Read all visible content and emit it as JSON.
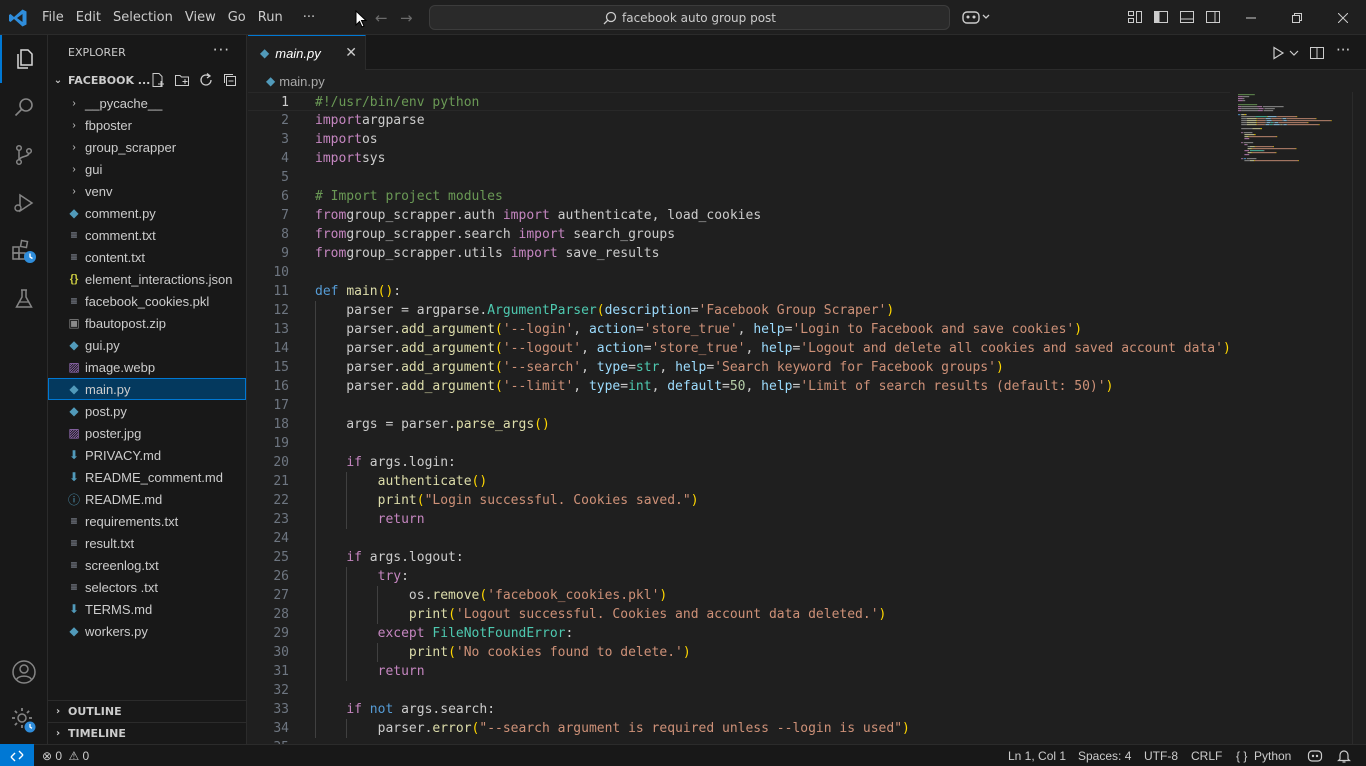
{
  "titlebar": {
    "menu": [
      "File",
      "Edit",
      "Selection",
      "View",
      "Go",
      "Run",
      "···"
    ],
    "search_text": "facebook auto group post",
    "window_controls": [
      "minimize-icon",
      "restore-icon",
      "close-icon"
    ]
  },
  "activitybar": {
    "items": [
      "explorer-icon",
      "search-icon",
      "source-control-icon",
      "run-debug-icon",
      "extensions-icon",
      "testing-icon"
    ],
    "bottom": [
      "account-icon",
      "manage-gear-icon"
    ]
  },
  "sidebar": {
    "title": "EXPLORER",
    "more": "···",
    "folder_name": "FACEBOOK ...",
    "items": [
      {
        "label": "__pycache__",
        "type": "folder"
      },
      {
        "label": "fbposter",
        "type": "folder"
      },
      {
        "label": "group_scrapper",
        "type": "folder"
      },
      {
        "label": "gui",
        "type": "folder"
      },
      {
        "label": "venv",
        "type": "folder"
      },
      {
        "label": "comment.py",
        "type": "py"
      },
      {
        "label": "comment.txt",
        "type": "txt"
      },
      {
        "label": "content.txt",
        "type": "txt"
      },
      {
        "label": "element_interactions.json",
        "type": "json"
      },
      {
        "label": "facebook_cookies.pkl",
        "type": "pkl"
      },
      {
        "label": "fbautopost.zip",
        "type": "zip"
      },
      {
        "label": "gui.py",
        "type": "py"
      },
      {
        "label": "image.webp",
        "type": "img"
      },
      {
        "label": "main.py",
        "type": "py",
        "selected": true
      },
      {
        "label": "post.py",
        "type": "py"
      },
      {
        "label": "poster.jpg",
        "type": "img"
      },
      {
        "label": "PRIVACY.md",
        "type": "md"
      },
      {
        "label": "README_comment.md",
        "type": "md"
      },
      {
        "label": "README.md",
        "type": "info"
      },
      {
        "label": "requirements.txt",
        "type": "txt"
      },
      {
        "label": "result.txt",
        "type": "txt"
      },
      {
        "label": "screenlog.txt",
        "type": "txt"
      },
      {
        "label": "selectors .txt",
        "type": "txt"
      },
      {
        "label": "TERMS.md",
        "type": "md"
      },
      {
        "label": "workers.py",
        "type": "py"
      }
    ],
    "outline": "OUTLINE",
    "timeline": "TIMELINE"
  },
  "editor": {
    "tab_label": "main.py",
    "breadcrumb": "main.py",
    "current_line": 1,
    "lines": [
      [
        [
          "c",
          "#!/usr/bin/env python"
        ]
      ],
      [
        [
          "kc",
          "import"
        ],
        [
          "",
          "argparse"
        ]
      ],
      [
        [
          "kc",
          "import"
        ],
        [
          "",
          "os"
        ]
      ],
      [
        [
          "kc",
          "import"
        ],
        [
          "",
          "sys"
        ]
      ],
      [],
      [
        [
          "c",
          "# Import project modules"
        ]
      ],
      [
        [
          "kc",
          "from"
        ],
        [
          "",
          "group_scrapper.auth "
        ],
        [
          "kc",
          "import"
        ],
        [
          "",
          " authenticate, load_cookies"
        ]
      ],
      [
        [
          "kc",
          "from"
        ],
        [
          "",
          "group_scrapper.search "
        ],
        [
          "kc",
          "import"
        ],
        [
          "",
          " search_groups"
        ]
      ],
      [
        [
          "kc",
          "from"
        ],
        [
          "",
          "group_scrapper.utils "
        ],
        [
          "kc",
          "import"
        ],
        [
          "",
          " save_results"
        ]
      ],
      [],
      [
        [
          "k",
          "def"
        ],
        [
          "",
          " "
        ],
        [
          "f",
          "main"
        ],
        [
          "p1",
          "()"
        ],
        [
          "",
          ":"
        ]
      ],
      [
        [
          "",
          "    parser = argparse."
        ],
        [
          "cl",
          "ArgumentParser"
        ],
        [
          "p1",
          "("
        ],
        [
          "v",
          "description"
        ],
        [
          "",
          "="
        ],
        [
          "s",
          "'Facebook Group Scraper'"
        ],
        [
          "p1",
          ")"
        ]
      ],
      [
        [
          "",
          "    parser."
        ],
        [
          "f",
          "add_argument"
        ],
        [
          "p1",
          "("
        ],
        [
          "s",
          "'--login'"
        ],
        [
          "",
          ", "
        ],
        [
          "v",
          "action"
        ],
        [
          "",
          "="
        ],
        [
          "s",
          "'store_true'"
        ],
        [
          "",
          ", "
        ],
        [
          "v",
          "help"
        ],
        [
          "",
          "="
        ],
        [
          "s",
          "'Login to Facebook and save cookies'"
        ],
        [
          "p1",
          ")"
        ]
      ],
      [
        [
          "",
          "    parser."
        ],
        [
          "f",
          "add_argument"
        ],
        [
          "p1",
          "("
        ],
        [
          "s",
          "'--logout'"
        ],
        [
          "",
          ", "
        ],
        [
          "v",
          "action"
        ],
        [
          "",
          "="
        ],
        [
          "s",
          "'store_true'"
        ],
        [
          "",
          ", "
        ],
        [
          "v",
          "help"
        ],
        [
          "",
          "="
        ],
        [
          "s",
          "'Logout and delete all cookies and saved account data'"
        ],
        [
          "p1",
          ")"
        ]
      ],
      [
        [
          "",
          "    parser."
        ],
        [
          "f",
          "add_argument"
        ],
        [
          "p1",
          "("
        ],
        [
          "s",
          "'--search'"
        ],
        [
          "",
          ", "
        ],
        [
          "v",
          "type"
        ],
        [
          "",
          "="
        ],
        [
          "cl",
          "str"
        ],
        [
          "",
          ", "
        ],
        [
          "v",
          "help"
        ],
        [
          "",
          "="
        ],
        [
          "s",
          "'Search keyword for Facebook groups'"
        ],
        [
          "p1",
          ")"
        ]
      ],
      [
        [
          "",
          "    parser."
        ],
        [
          "f",
          "add_argument"
        ],
        [
          "p1",
          "("
        ],
        [
          "s",
          "'--limit'"
        ],
        [
          "",
          ", "
        ],
        [
          "v",
          "type"
        ],
        [
          "",
          "="
        ],
        [
          "cl",
          "int"
        ],
        [
          "",
          ", "
        ],
        [
          "v",
          "default"
        ],
        [
          "",
          "="
        ],
        [
          "n",
          "50"
        ],
        [
          "",
          ", "
        ],
        [
          "v",
          "help"
        ],
        [
          "",
          "="
        ],
        [
          "s",
          "'Limit of search results (default: 50)'"
        ],
        [
          "p1",
          ")"
        ]
      ],
      [],
      [
        [
          "",
          "    args = parser."
        ],
        [
          "f",
          "parse_args"
        ],
        [
          "p1",
          "()"
        ]
      ],
      [],
      [
        [
          "",
          "    "
        ],
        [
          "kc",
          "if"
        ],
        [
          "",
          " args.login:"
        ]
      ],
      [
        [
          "",
          "        "
        ],
        [
          "f",
          "authenticate"
        ],
        [
          "p1",
          "()"
        ]
      ],
      [
        [
          "",
          "        "
        ],
        [
          "f",
          "print"
        ],
        [
          "p1",
          "("
        ],
        [
          "s",
          "\"Login successful. Cookies saved.\""
        ],
        [
          "p1",
          ")"
        ]
      ],
      [
        [
          "",
          "        "
        ],
        [
          "kc",
          "return"
        ]
      ],
      [],
      [
        [
          "",
          "    "
        ],
        [
          "kc",
          "if"
        ],
        [
          "",
          " args.logout:"
        ]
      ],
      [
        [
          "",
          "        "
        ],
        [
          "kc",
          "try"
        ],
        [
          "",
          ":"
        ]
      ],
      [
        [
          "",
          "            os."
        ],
        [
          "f",
          "remove"
        ],
        [
          "p1",
          "("
        ],
        [
          "s",
          "'facebook_cookies.pkl'"
        ],
        [
          "p1",
          ")"
        ]
      ],
      [
        [
          "",
          "            "
        ],
        [
          "f",
          "print"
        ],
        [
          "p1",
          "("
        ],
        [
          "s",
          "'Logout successful. Cookies and account data deleted.'"
        ],
        [
          "p1",
          ")"
        ]
      ],
      [
        [
          "",
          "        "
        ],
        [
          "kc",
          "except"
        ],
        [
          "",
          " "
        ],
        [
          "cl",
          "FileNotFoundError"
        ],
        [
          "",
          ":"
        ]
      ],
      [
        [
          "",
          "            "
        ],
        [
          "f",
          "print"
        ],
        [
          "p1",
          "("
        ],
        [
          "s",
          "'No cookies found to delete.'"
        ],
        [
          "p1",
          ")"
        ]
      ],
      [
        [
          "",
          "        "
        ],
        [
          "kc",
          "return"
        ]
      ],
      [],
      [
        [
          "",
          "    "
        ],
        [
          "kc",
          "if"
        ],
        [
          "",
          " "
        ],
        [
          "k",
          "not"
        ],
        [
          "",
          " args.search:"
        ]
      ],
      [
        [
          "",
          "        parser."
        ],
        [
          "f",
          "error"
        ],
        [
          "p1",
          "("
        ],
        [
          "s",
          "\"--search argument is required unless --login is used\""
        ],
        [
          "p1",
          ")"
        ]
      ],
      []
    ]
  },
  "statusbar": {
    "errors": "0",
    "warnings": "0",
    "position": "Ln 1, Col 1",
    "spaces": "Spaces: 4",
    "encoding": "UTF-8",
    "eol": "CRLF",
    "language_braces": "{ }",
    "language": "Python"
  },
  "colors": {
    "accent": "#0078d4",
    "keyword": "#569cd6",
    "control": "#c586c0",
    "function": "#dcdcaa",
    "string": "#ce9178",
    "comment": "#6a9955",
    "number": "#b5cea8",
    "param": "#9cdcfe",
    "type": "#4ec9b0"
  }
}
